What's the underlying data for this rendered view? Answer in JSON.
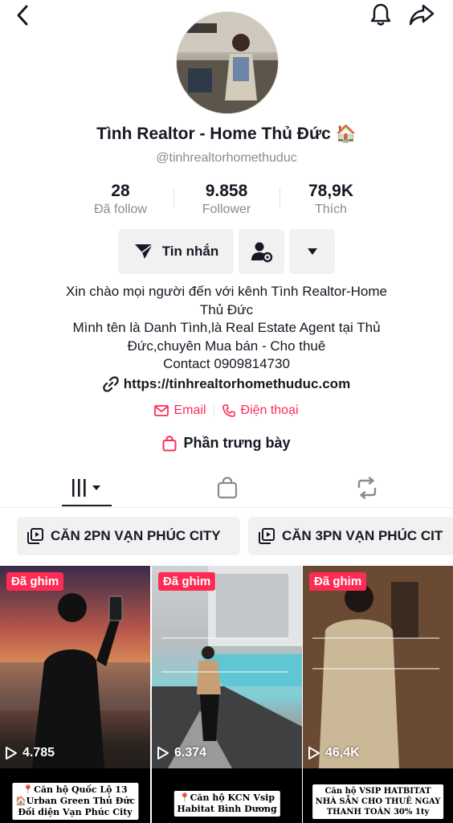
{
  "header": {
    "back_icon": "chevron-left-icon",
    "bell_icon": "bell-icon",
    "share_icon": "share-arrow-icon"
  },
  "profile": {
    "name": "Tình Realtor - Home Thủ Đức 🏠",
    "handle": "@tinhrealtorhomethuduc"
  },
  "stats": [
    {
      "value": "28",
      "label": "Đã follow"
    },
    {
      "value": "9.858",
      "label": "Follower"
    },
    {
      "value": "78,9K",
      "label": "Thích"
    }
  ],
  "actions": {
    "message_label": "Tin nhắn",
    "user_settings_icon": "user-gear-icon",
    "more_icon": "caret-down-icon"
  },
  "bio": {
    "lines": [
      "Xin chào mọi người đến với kênh Tình Realtor-Home",
      "Thủ Đức",
      "Mình tên là Danh Tình,là Real Estate Agent tại Thủ",
      "Đức,chuyên Mua bán - Cho thuê",
      "Contact 0909814730"
    ],
    "link": "https://tinhrealtorhomethuduc.com",
    "email_label": "Email",
    "phone_label": "Điện thoại",
    "showcase_label": "Phần trưng bày"
  },
  "tabs": {
    "videos_icon": "grid-bars-icon",
    "shop_icon": "shopping-bag-icon",
    "repost_icon": "repost-icon"
  },
  "playlists": [
    {
      "label": "CĂN 2PN VẠN PHÚC CITY"
    },
    {
      "label": "CĂN 3PN VẠN PHÚC CIT"
    }
  ],
  "videos": [
    {
      "pinned_label": "Đã ghim",
      "views": "4.785",
      "caption_lines": [
        "📍Căn hộ Quốc Lộ 13",
        "🏠Urban Green Thủ Đức",
        "Đối diện Vạn Phúc City"
      ]
    },
    {
      "pinned_label": "Đã ghim",
      "views": "6.374",
      "caption_lines": [
        "📍Căn hộ KCN Vsip",
        "Habitat Bình Dương"
      ]
    },
    {
      "pinned_label": "Đã ghim",
      "views": "46,4K",
      "caption_lines": [
        "Căn hộ VSIP HATBITAT",
        "NHÀ SẴN CHO THUÊ NGAY",
        "THANH TOÁN 30% 1ty"
      ]
    }
  ],
  "colors": {
    "accent": "#fe2c55",
    "muted_text": "#8a8b91",
    "button_bg": "#f1f1f2"
  }
}
